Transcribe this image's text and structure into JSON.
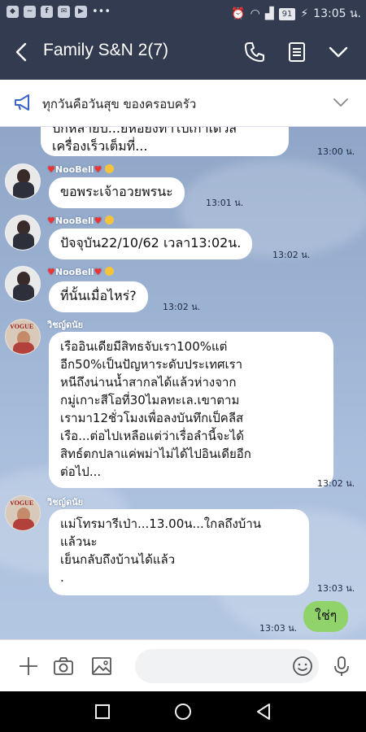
{
  "status_bar": {
    "battery": "91",
    "time": "13:05 น."
  },
  "header": {
    "title": "Family S&N 2(7)"
  },
  "announcement": {
    "text": "ทุกวันคือวันสุข ของครอบครัว"
  },
  "messages": [
    {
      "id": 0,
      "text": "ปีกหลายปี...ยี่ห้อยังทำไปเก่าเดวิส\nเครื่องเร็วเต็มที่...",
      "time": "13:00 น."
    },
    {
      "id": 1,
      "sender": "NooBell",
      "text": "ขอพระเจ้าอวยพรนะ",
      "time": "13:01 น."
    },
    {
      "id": 2,
      "sender": "NooBell",
      "text": "ปัจจุบัน22/10/62 เวลา13:02น.",
      "time": "13:02 น."
    },
    {
      "id": 3,
      "sender": "NooBell",
      "text": "ที่นั้นเมื่อไหร่?",
      "time": "13:02 น."
    },
    {
      "id": 4,
      "sender": "วิชญ์ดนัย",
      "text": "เรืออินเดียมีสิทธจับเรา100%แต่\nอีก50%เป็นปัญหาระดับประเทศเรา\nหนีถึงน่านน้ำสากลได้แล้วห่างจาก\nกมู่เกาะสีโอที่30ไมลทะเล.เขาตาม\nเรามา12ชั่วโมงเพื่อลงบันทึกเป็คลีส\nเรือ...ต่อไปเหลือแต่ว่าเรื่อลำนี้จะได้\nสิทธ์ตกปลาแค่พม่าไม่ได้ไปอินเดียอีก\nต่อไป...",
      "time": "13:02 น."
    },
    {
      "id": 5,
      "sender": "วิชญ์ดนัย",
      "text": "แม่โทรมารีเป่า...13.00น...ใกลถึงบ้าน\nแล้วนะ\nเย็นกลับถึงบ้านได้แล้ว\n.",
      "time": "13:03 น."
    },
    {
      "id": 6,
      "text": "ใช่ๆ",
      "time": "13:03 น."
    }
  ]
}
